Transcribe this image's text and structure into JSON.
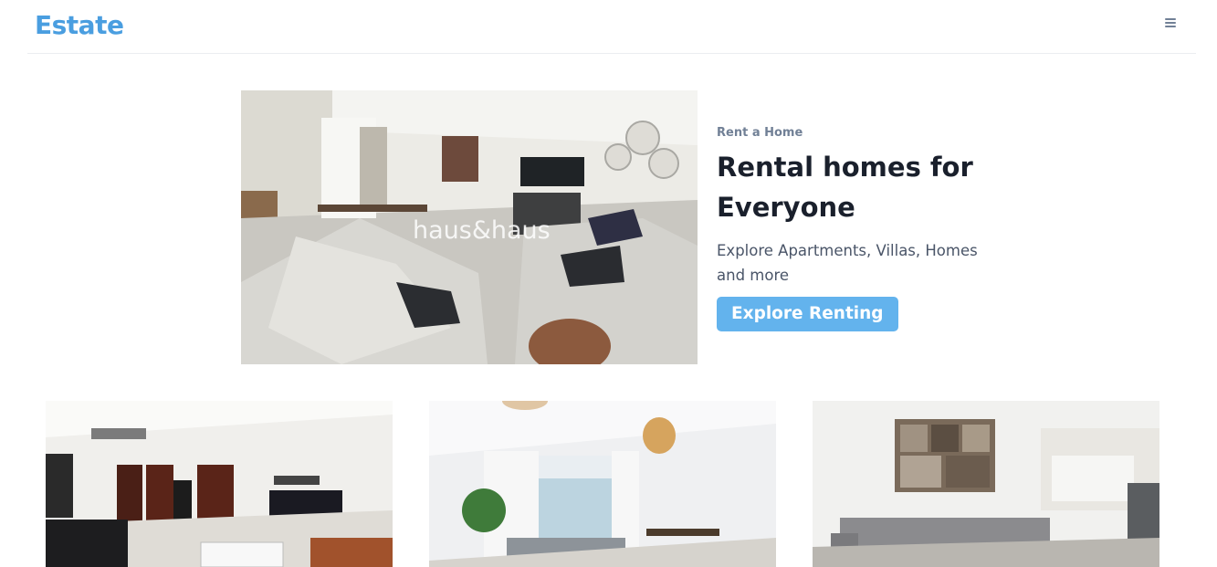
{
  "nav": {
    "brand": "Estate",
    "menu_icon": "hamburger-menu-icon"
  },
  "hero": {
    "eyebrow": "Rent a Home",
    "title": "Rental homes for Everyone",
    "description": "Explore Apartments, Villas, Homes and more",
    "cta_label": "Explore Renting",
    "image_watermark": "haus&haus"
  },
  "listings": [
    {
      "image": "bedroom-studio-photo"
    },
    {
      "image": "living-dining-room-photo"
    },
    {
      "image": "living-room-kitchen-photo"
    }
  ],
  "colors": {
    "brand": "#4a9ee0",
    "cta": "#63b3ed",
    "text": "#1a202c",
    "muted": "#718096"
  }
}
